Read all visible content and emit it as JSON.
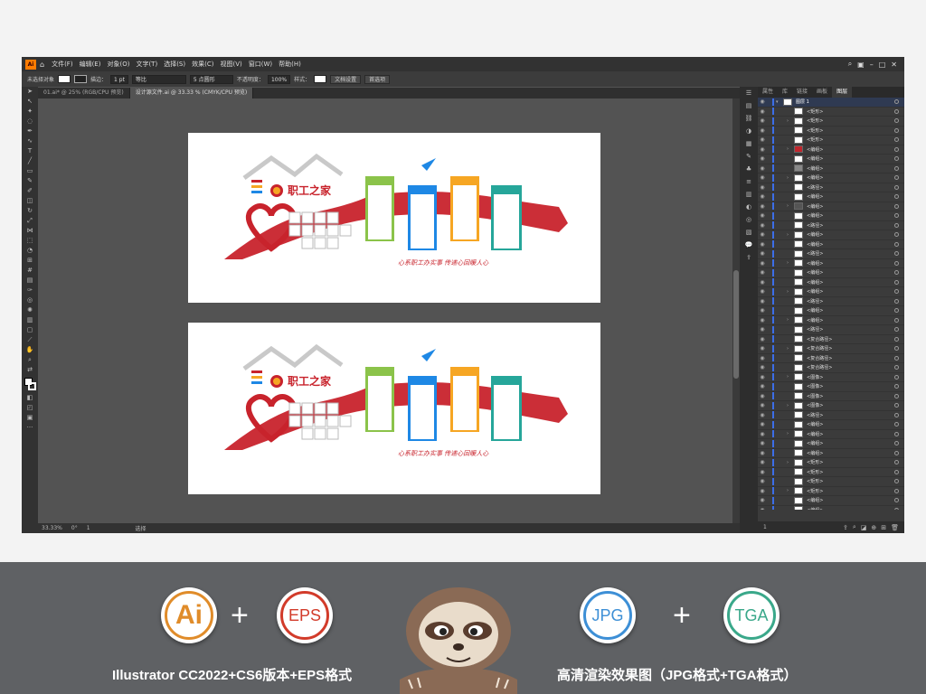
{
  "app": {
    "logo_text": "Ai",
    "menu": [
      "文件(F)",
      "编辑(E)",
      "对象(O)",
      "文字(T)",
      "选择(S)",
      "效果(C)",
      "视图(V)",
      "窗口(W)",
      "帮助(H)"
    ]
  },
  "control_bar": {
    "selection": "未选择对象",
    "stroke_label": "描边：",
    "stroke_value": "1 pt",
    "profile": "等比",
    "brush": "5 点圆形",
    "opacity_label": "不透明度：",
    "opacity_value": "100%",
    "style_label": "样式：",
    "doc_setup": "文档设置",
    "preferences": "首选项"
  },
  "tabs": [
    {
      "label": "01.ai* @ 25% (RGB/CPU 预览)",
      "active": false
    },
    {
      "label": "设计源文件.ai @ 33.33 % (CMYK/CPU 预览)",
      "active": true
    }
  ],
  "status": {
    "zoom": "33.33%",
    "angle": "0°",
    "page": "1",
    "tool": "选择"
  },
  "panel": {
    "tabs": [
      "属性",
      "库",
      "链接",
      "画板",
      "图层"
    ],
    "active_tab": "图层",
    "count": "1",
    "layers": [
      {
        "name": "图层 1",
        "top": true,
        "thumb": "#ffffff"
      },
      {
        "name": "<矩形>",
        "thumb": "#ffffff"
      },
      {
        "name": "<矩形>",
        "thumb": "#ffffff"
      },
      {
        "name": "<矩形>",
        "thumb": "#ffffff"
      },
      {
        "name": "<矩形>",
        "thumb": "#ffffff"
      },
      {
        "name": "<编组>",
        "thumb": "#c0262d"
      },
      {
        "name": "<编组>",
        "thumb": "#ffffff"
      },
      {
        "name": "<编组>",
        "thumb": "#888888"
      },
      {
        "name": "<编组>",
        "thumb": "#ffffff"
      },
      {
        "name": "<路径>",
        "thumb": "#ffffff"
      },
      {
        "name": "<编组>",
        "thumb": "#ffffff"
      },
      {
        "name": "<编组>",
        "thumb": "#555555"
      },
      {
        "name": "<编组>",
        "thumb": "#ffffff"
      },
      {
        "name": "<路径>",
        "thumb": "#ffffff"
      },
      {
        "name": "<编组>",
        "thumb": "#ffffff"
      },
      {
        "name": "<编组>",
        "thumb": "#ffffff"
      },
      {
        "name": "<路径>",
        "thumb": "#ffffff"
      },
      {
        "name": "<编组>",
        "thumb": "#ffffff"
      },
      {
        "name": "<编组>",
        "thumb": "#ffffff"
      },
      {
        "name": "<编组>",
        "thumb": "#ffffff"
      },
      {
        "name": "<编组>",
        "thumb": "#ffffff"
      },
      {
        "name": "<路径>",
        "thumb": "#ffffff"
      },
      {
        "name": "<编组>",
        "thumb": "#ffffff"
      },
      {
        "name": "<编组>",
        "thumb": "#ffffff"
      },
      {
        "name": "<路径>",
        "thumb": "#ffffff"
      },
      {
        "name": "<复合路径>",
        "thumb": "#ffffff"
      },
      {
        "name": "<复合路径>",
        "thumb": "#ffffff"
      },
      {
        "name": "<复合路径>",
        "thumb": "#ffffff"
      },
      {
        "name": "<复合路径>",
        "thumb": "#ffffff"
      },
      {
        "name": "<图像>",
        "thumb": "#ffffff"
      },
      {
        "name": "<图像>",
        "thumb": "#ffffff"
      },
      {
        "name": "<图像>",
        "thumb": "#ffffff"
      },
      {
        "name": "<图像>",
        "thumb": "#ffffff"
      },
      {
        "name": "<路径>",
        "thumb": "#ffffff"
      },
      {
        "name": "<编组>",
        "thumb": "#ffffff"
      },
      {
        "name": "<编组>",
        "thumb": "#ffffff"
      },
      {
        "name": "<编组>",
        "thumb": "#ffffff"
      },
      {
        "name": "<编组>",
        "thumb": "#ffffff"
      },
      {
        "name": "<矩形>",
        "thumb": "#ffffff"
      },
      {
        "name": "<矩形>",
        "thumb": "#ffffff"
      },
      {
        "name": "<矩形>",
        "thumb": "#ffffff"
      },
      {
        "name": "<矩形>",
        "thumb": "#ffffff"
      },
      {
        "name": "<编组>",
        "thumb": "#ffffff"
      },
      {
        "name": "<编组>",
        "thumb": "#ffffff"
      }
    ]
  },
  "artwork": {
    "title": "职工之家",
    "slogan": "心系职工办实事  传递心回暖人心",
    "colors": {
      "red": "#c8232c",
      "green": "#8bc34a",
      "blue": "#1e88e5",
      "orange": "#f6a623",
      "teal": "#26a69a"
    }
  },
  "promo": {
    "formats": [
      "Ai",
      "EPS",
      "JPG",
      "TGA"
    ],
    "left_caption": "Illustrator CC2022+CS6版本+EPS格式",
    "right_caption": "高清渲染效果图（JPG格式+TGA格式）"
  }
}
